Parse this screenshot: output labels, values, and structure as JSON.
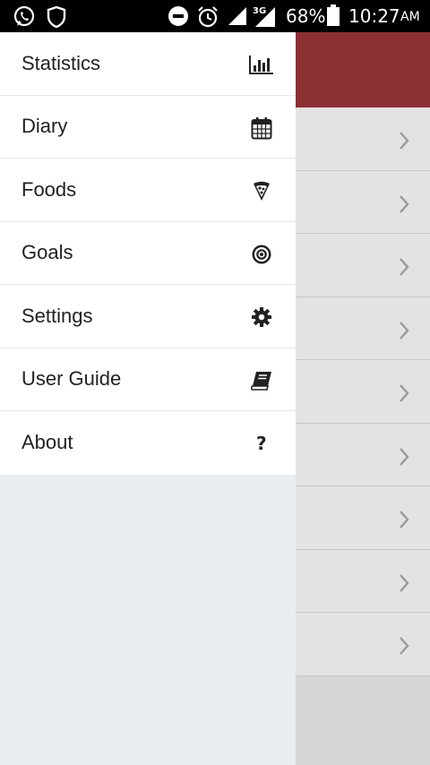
{
  "status_bar": {
    "battery": "68%",
    "time": "10:27",
    "ampm": "AM",
    "network": "3G",
    "icons": [
      "whatsapp-icon",
      "shield-icon",
      "dnd-icon",
      "alarm-icon",
      "signal-icon",
      "network-signal-icon",
      "battery-icon"
    ]
  },
  "drawer": {
    "items": [
      {
        "label": "Statistics",
        "icon": "bar-chart-icon"
      },
      {
        "label": "Diary",
        "icon": "calendar-icon"
      },
      {
        "label": "Foods",
        "icon": "pizza-icon"
      },
      {
        "label": "Goals",
        "icon": "target-icon"
      },
      {
        "label": "Settings",
        "icon": "gear-icon"
      },
      {
        "label": "User Guide",
        "icon": "book-icon"
      },
      {
        "label": "About",
        "icon": "question-icon"
      }
    ]
  },
  "background": {
    "header_color": "#8c3034",
    "row_count": 9
  },
  "colors": {
    "accent": "#8c3034",
    "drawer_bg": "#e9edf0",
    "menu_bg": "#ffffff",
    "text": "#222222"
  }
}
